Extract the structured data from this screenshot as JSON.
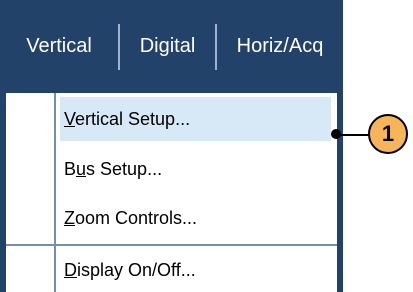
{
  "menubar": {
    "items": [
      {
        "label": "Vertical"
      },
      {
        "label": "Digital"
      },
      {
        "label": "Horiz/Acq"
      }
    ]
  },
  "dropdown": {
    "items": [
      {
        "pre": "",
        "u": "V",
        "post": "ertical Setup...",
        "selected": true
      },
      {
        "pre": "B",
        "u": "u",
        "post": "s Setup...",
        "selected": false
      },
      {
        "pre": "",
        "u": "Z",
        "post": "oom Controls...",
        "selected": false
      },
      {
        "pre": "",
        "u": "D",
        "post": "isplay On/Off...",
        "selected": false
      }
    ]
  },
  "callout": {
    "number": "1"
  }
}
